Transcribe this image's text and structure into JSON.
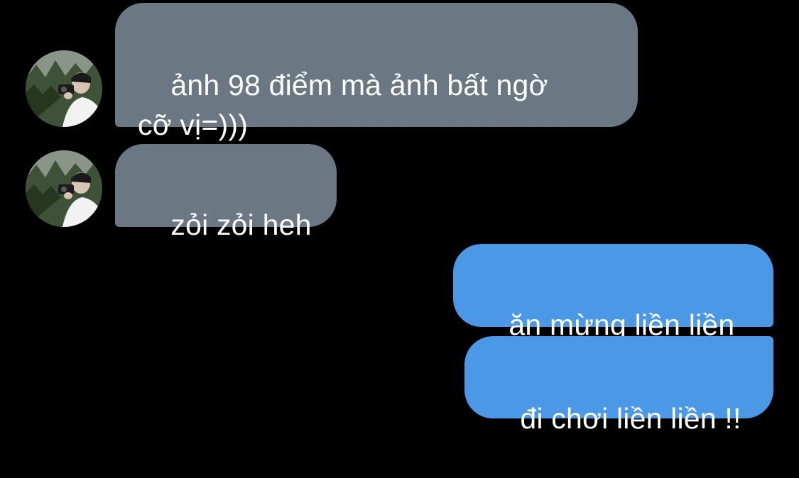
{
  "conversation": {
    "messages": [
      {
        "sender": "contact",
        "text": "ảnh 98 điểm mà ảnh bất ngờ\ncỡ vị=)))"
      },
      {
        "sender": "contact",
        "text": "zỏi zỏi heh"
      },
      {
        "sender": "me",
        "text": "ăn mừng liền liền"
      },
      {
        "sender": "me",
        "text": "đi chơi liền liền !!"
      }
    ]
  },
  "colors": {
    "background": "#000000",
    "incoming_bubble": "#6c7784",
    "outgoing_bubble": "#4b98e6",
    "text": "#ffffff"
  },
  "icons": {
    "contact_avatar": "avatar-photo-person-with-camera"
  }
}
